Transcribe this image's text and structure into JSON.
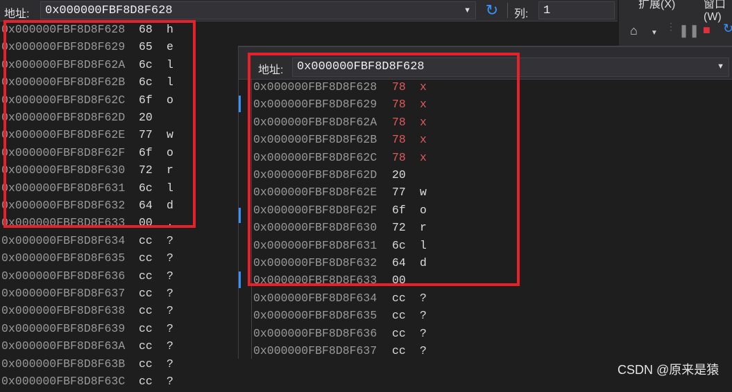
{
  "left_window": {
    "address_label": "地址:",
    "address_value": "0x000000FBF8D8F628",
    "column_label": "列:",
    "column_value": "1",
    "rows": [
      {
        "addr": "0x000000FBF8D8F628",
        "hex": "68",
        "ch": "h"
      },
      {
        "addr": "0x000000FBF8D8F629",
        "hex": "65",
        "ch": "e"
      },
      {
        "addr": "0x000000FBF8D8F62A",
        "hex": "6c",
        "ch": "l"
      },
      {
        "addr": "0x000000FBF8D8F62B",
        "hex": "6c",
        "ch": "l"
      },
      {
        "addr": "0x000000FBF8D8F62C",
        "hex": "6f",
        "ch": "o"
      },
      {
        "addr": "0x000000FBF8D8F62D",
        "hex": "20",
        "ch": ""
      },
      {
        "addr": "0x000000FBF8D8F62E",
        "hex": "77",
        "ch": "w"
      },
      {
        "addr": "0x000000FBF8D8F62F",
        "hex": "6f",
        "ch": "o"
      },
      {
        "addr": "0x000000FBF8D8F630",
        "hex": "72",
        "ch": "r"
      },
      {
        "addr": "0x000000FBF8D8F631",
        "hex": "6c",
        "ch": "l"
      },
      {
        "addr": "0x000000FBF8D8F632",
        "hex": "64",
        "ch": "d"
      },
      {
        "addr": "0x000000FBF8D8F633",
        "hex": "00",
        "ch": "."
      },
      {
        "addr": "0x000000FBF8D8F634",
        "hex": "cc",
        "ch": "?"
      },
      {
        "addr": "0x000000FBF8D8F635",
        "hex": "cc",
        "ch": "?"
      },
      {
        "addr": "0x000000FBF8D8F636",
        "hex": "cc",
        "ch": "?"
      },
      {
        "addr": "0x000000FBF8D8F637",
        "hex": "cc",
        "ch": "?"
      },
      {
        "addr": "0x000000FBF8D8F638",
        "hex": "cc",
        "ch": "?"
      },
      {
        "addr": "0x000000FBF8D8F639",
        "hex": "cc",
        "ch": "?"
      },
      {
        "addr": "0x000000FBF8D8F63A",
        "hex": "cc",
        "ch": "?"
      },
      {
        "addr": "0x000000FBF8D8F63B",
        "hex": "cc",
        "ch": "?"
      },
      {
        "addr": "0x000000FBF8D8F63C",
        "hex": "cc",
        "ch": "?"
      }
    ]
  },
  "ide_menu": {
    "extensions": "扩展(X)",
    "window": "窗口(W)"
  },
  "right_window": {
    "address_label": "地址:",
    "address_value": "0x000000FBF8D8F628",
    "rows": [
      {
        "addr": "0x000000FBF8D8F628",
        "hex": "78",
        "ch": "x",
        "changed": true
      },
      {
        "addr": "0x000000FBF8D8F629",
        "hex": "78",
        "ch": "x",
        "changed": true
      },
      {
        "addr": "0x000000FBF8D8F62A",
        "hex": "78",
        "ch": "x",
        "changed": true
      },
      {
        "addr": "0x000000FBF8D8F62B",
        "hex": "78",
        "ch": "x",
        "changed": true
      },
      {
        "addr": "0x000000FBF8D8F62C",
        "hex": "78",
        "ch": "x",
        "changed": true
      },
      {
        "addr": "0x000000FBF8D8F62D",
        "hex": "20",
        "ch": "",
        "changed": false
      },
      {
        "addr": "0x000000FBF8D8F62E",
        "hex": "77",
        "ch": "w",
        "changed": false
      },
      {
        "addr": "0x000000FBF8D8F62F",
        "hex": "6f",
        "ch": "o",
        "changed": false
      },
      {
        "addr": "0x000000FBF8D8F630",
        "hex": "72",
        "ch": "r",
        "changed": false
      },
      {
        "addr": "0x000000FBF8D8F631",
        "hex": "6c",
        "ch": "l",
        "changed": false
      },
      {
        "addr": "0x000000FBF8D8F632",
        "hex": "64",
        "ch": "d",
        "changed": false
      },
      {
        "addr": "0x000000FBF8D8F633",
        "hex": "00",
        "ch": "",
        "changed": false
      },
      {
        "addr": "0x000000FBF8D8F634",
        "hex": "cc",
        "ch": "?",
        "changed": false
      },
      {
        "addr": "0x000000FBF8D8F635",
        "hex": "cc",
        "ch": "?",
        "changed": false
      },
      {
        "addr": "0x000000FBF8D8F636",
        "hex": "cc",
        "ch": "?",
        "changed": false
      },
      {
        "addr": "0x000000FBF8D8F637",
        "hex": "cc",
        "ch": "?",
        "changed": false
      }
    ]
  },
  "watermark": "CSDN @原来是猿",
  "colors": {
    "highlight_box": "#e8202a",
    "changed_value": "#e05a5a",
    "accent": "#3794ff"
  },
  "icons": [
    "refresh-icon",
    "dropdown-arrow-icon",
    "stop-icon",
    "pause-icon",
    "restart-icon",
    "toolbox-icon"
  ]
}
